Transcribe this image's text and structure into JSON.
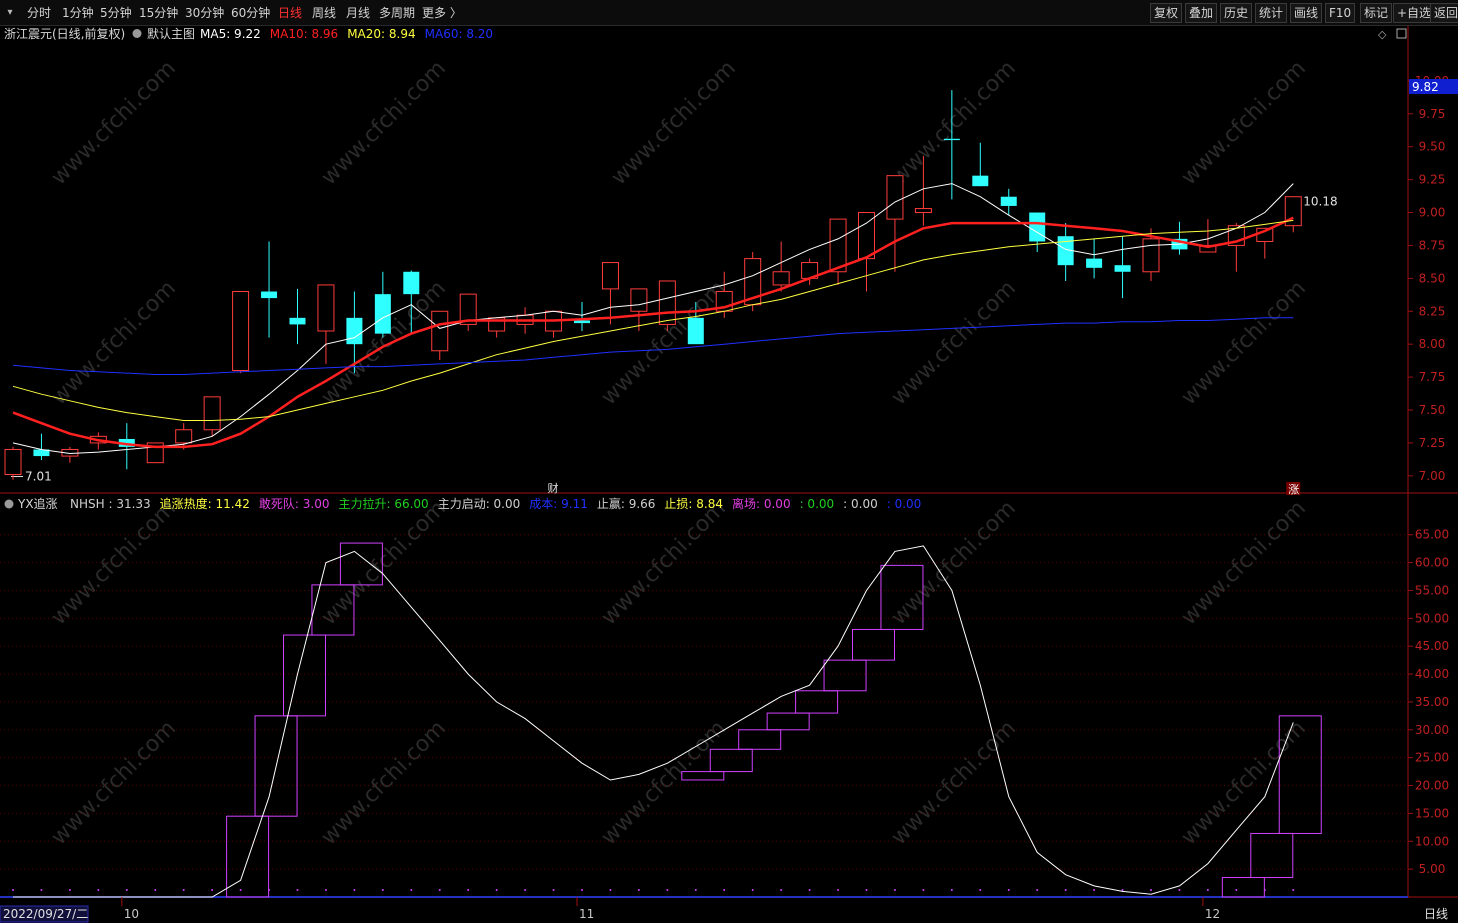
{
  "toolbar": {
    "periods": [
      "分时",
      "1分钟",
      "5分钟",
      "15分钟",
      "30分钟",
      "60分钟",
      "日线",
      "周线",
      "月线",
      "多周期",
      "更多 〉"
    ],
    "active_period": "日线",
    "right": [
      "复权",
      "叠加",
      "历史",
      "统计",
      "画线",
      "F10",
      "标记",
      "+自选",
      "返回"
    ]
  },
  "main_legend": {
    "stock": "浙江震元(日线,前复权)",
    "template": "默认主图",
    "items": [
      {
        "label": "MA5: 9.22",
        "color": "#ffffff"
      },
      {
        "label": "MA10: 8.96",
        "color": "#ff2020"
      },
      {
        "label": "MA20: 8.94",
        "color": "#ffff40"
      },
      {
        "label": "MA60: 8.20",
        "color": "#2030ff"
      }
    ]
  },
  "sub_legend": {
    "name": "YX追涨",
    "items": [
      {
        "label": "NHSH : 31.33",
        "color": "#d0d0d0"
      },
      {
        "label": "追涨热度: 11.42",
        "color": "#ffff40"
      },
      {
        "label": "敢死队: 3.00",
        "color": "#e040e0"
      },
      {
        "label": "主力拉升: 66.00",
        "color": "#20d020"
      },
      {
        "label": "主力启动: 0.00",
        "color": "#d0d0d0"
      },
      {
        "label": "成本: 9.11",
        "color": "#2030ff"
      },
      {
        "label": "止赢: 9.66",
        "color": "#d0d0d0"
      },
      {
        "label": "止损: 8.84",
        "color": "#ffff40"
      },
      {
        "label": "离场: 0.00",
        "color": "#e040e0"
      },
      {
        "label": ": 0.00",
        "color": "#20d020"
      },
      {
        "label": ": 0.00",
        "color": "#d0d0d0"
      },
      {
        "label": ": 0.00",
        "color": "#2030ff"
      }
    ]
  },
  "price_badge": "9.82",
  "max_label": "10.18",
  "min_label": "7.01",
  "markers": {
    "cai": "财",
    "zhang": "涨"
  },
  "date_label": "2022/09/27/二",
  "period_label": "日线",
  "watermark": "www.cfchi.com",
  "colors": {
    "up": "#ff3c3c",
    "down": "#30ffff",
    "ma5": "#ffffff",
    "ma10": "#ff2020",
    "ma20": "#ffff40",
    "ma60": "#2030ff",
    "sub_line": "#ffffff",
    "sub_box": "#d040ff",
    "grid": "#5a0000",
    "axis": "#a01010"
  },
  "chart_data": [
    {
      "type": "candlestick",
      "x": [
        "09-27",
        "09-28",
        "09-29",
        "09-30",
        "10-10",
        "10-11",
        "10-12",
        "10-13",
        "10-14",
        "10-17",
        "10-18",
        "10-19",
        "10-20",
        "10-21",
        "10-24",
        "10-25",
        "10-26",
        "10-27",
        "10-28",
        "10-31",
        "11-01",
        "11-02",
        "11-03",
        "11-04",
        "11-07",
        "11-08",
        "11-09",
        "11-10",
        "11-11",
        "11-14",
        "11-15",
        "11-16",
        "11-17",
        "11-18",
        "11-21",
        "11-22",
        "11-23",
        "11-24",
        "11-25",
        "11-28",
        "11-29",
        "11-30",
        "12-01",
        "12-02",
        "12-05",
        "12-06"
      ],
      "open": [
        7.01,
        7.2,
        7.15,
        7.25,
        7.28,
        7.1,
        7.25,
        7.35,
        7.8,
        8.4,
        8.2,
        8.1,
        8.2,
        8.38,
        8.55,
        7.95,
        8.15,
        8.1,
        8.15,
        8.1,
        8.18,
        8.42,
        8.25,
        8.15,
        8.2,
        8.25,
        8.3,
        8.45,
        8.5,
        8.55,
        8.65,
        8.95,
        9.0,
        9.56,
        9.28,
        9.12,
        9.0,
        8.82,
        8.65,
        8.6,
        8.55,
        8.8,
        8.7,
        8.75,
        8.78,
        8.9
      ],
      "high": [
        7.22,
        7.32,
        7.22,
        7.33,
        7.4,
        7.25,
        7.4,
        7.6,
        8.4,
        8.78,
        8.42,
        8.28,
        8.4,
        8.55,
        8.56,
        8.1,
        8.3,
        8.2,
        8.28,
        8.25,
        8.32,
        8.52,
        8.35,
        8.3,
        8.32,
        8.55,
        8.7,
        8.78,
        8.65,
        8.62,
        9.0,
        9.28,
        9.43,
        9.93,
        9.53,
        9.18,
        9.0,
        8.92,
        8.8,
        8.82,
        8.88,
        8.93,
        8.95,
        8.92,
        8.8,
        9.1
      ],
      "low": [
        6.97,
        7.12,
        7.1,
        7.2,
        7.05,
        7.1,
        7.2,
        7.3,
        7.78,
        8.05,
        8.0,
        7.85,
        7.78,
        8.05,
        8.08,
        7.88,
        8.1,
        8.05,
        8.08,
        8.05,
        8.1,
        8.15,
        8.1,
        8.1,
        8.08,
        8.2,
        8.25,
        8.4,
        8.45,
        8.45,
        8.4,
        8.55,
        8.9,
        9.1,
        9.2,
        8.98,
        8.7,
        8.48,
        8.5,
        8.35,
        8.48,
        8.68,
        8.7,
        8.55,
        8.65,
        8.85
      ],
      "close": [
        7.2,
        7.15,
        7.2,
        7.3,
        7.22,
        7.25,
        7.35,
        7.6,
        8.4,
        8.35,
        8.15,
        8.45,
        8.0,
        8.08,
        8.38,
        8.25,
        8.38,
        8.2,
        8.22,
        8.25,
        8.16,
        8.62,
        8.42,
        8.48,
        8.0,
        8.4,
        8.65,
        8.55,
        8.62,
        8.95,
        9.0,
        9.28,
        9.03,
        9.55,
        9.2,
        9.05,
        8.78,
        8.6,
        8.58,
        8.55,
        8.8,
        8.72,
        8.75,
        8.9,
        8.88,
        9.12
      ]
    },
    {
      "type": "line",
      "x_ref": "candlestick.x",
      "series": [
        {
          "name": "MA5",
          "values": [
            7.25,
            7.2,
            7.17,
            7.18,
            7.2,
            7.22,
            7.24,
            7.3,
            7.45,
            7.62,
            7.8,
            8.0,
            8.05,
            8.2,
            8.3,
            8.12,
            8.18,
            8.2,
            8.22,
            8.25,
            8.22,
            8.28,
            8.3,
            8.35,
            8.4,
            8.45,
            8.52,
            8.62,
            8.72,
            8.8,
            8.92,
            9.08,
            9.18,
            9.22,
            9.12,
            8.98,
            8.85,
            8.72,
            8.68,
            8.72,
            8.75,
            8.76,
            8.8,
            8.88,
            9.0,
            9.22
          ]
        },
        {
          "name": "MA10",
          "values": [
            7.48,
            7.4,
            7.32,
            7.27,
            7.24,
            7.22,
            7.22,
            7.24,
            7.32,
            7.45,
            7.6,
            7.72,
            7.85,
            7.98,
            8.08,
            8.15,
            8.18,
            8.18,
            8.18,
            8.18,
            8.19,
            8.2,
            8.22,
            8.24,
            8.25,
            8.28,
            8.35,
            8.42,
            8.5,
            8.58,
            8.66,
            8.78,
            8.88,
            8.92,
            8.92,
            8.92,
            8.92,
            8.9,
            8.88,
            8.86,
            8.82,
            8.78,
            8.74,
            8.78,
            8.86,
            8.96
          ]
        },
        {
          "name": "MA20",
          "values": [
            7.68,
            7.62,
            7.57,
            7.52,
            7.48,
            7.45,
            7.42,
            7.42,
            7.43,
            7.45,
            7.5,
            7.55,
            7.6,
            7.65,
            7.72,
            7.78,
            7.85,
            7.92,
            7.97,
            8.02,
            8.06,
            8.1,
            8.14,
            8.18,
            8.21,
            8.25,
            8.3,
            8.34,
            8.4,
            8.46,
            8.52,
            8.58,
            8.64,
            8.68,
            8.71,
            8.74,
            8.76,
            8.78,
            8.8,
            8.82,
            8.84,
            8.85,
            8.86,
            8.88,
            8.91,
            8.94
          ]
        },
        {
          "name": "MA60",
          "values": [
            7.84,
            7.82,
            7.8,
            7.79,
            7.78,
            7.77,
            7.77,
            7.78,
            7.79,
            7.8,
            7.81,
            7.82,
            7.83,
            7.83,
            7.84,
            7.85,
            7.86,
            7.87,
            7.88,
            7.9,
            7.92,
            7.94,
            7.95,
            7.96,
            7.98,
            8.0,
            8.02,
            8.04,
            8.06,
            8.08,
            8.09,
            8.1,
            8.11,
            8.12,
            8.13,
            8.14,
            8.15,
            8.16,
            8.16,
            8.17,
            8.17,
            8.18,
            8.18,
            8.19,
            8.2,
            8.2
          ]
        }
      ],
      "ylim": [
        6.9,
        10.28
      ],
      "y_ticks": [
        7.0,
        7.25,
        7.5,
        7.75,
        8.0,
        8.25,
        8.5,
        8.75,
        9.0,
        9.25,
        9.5,
        9.75,
        10.0
      ],
      "grid": false
    },
    {
      "type": "line",
      "name": "YX追涨",
      "x_ref": "candlestick.x",
      "series": [
        {
          "name": "NHSH",
          "values": [
            0,
            0,
            0,
            0,
            0,
            0,
            0,
            0,
            3,
            18,
            40,
            60,
            62,
            58,
            52,
            46,
            40,
            35,
            32,
            28,
            24,
            21,
            22,
            24,
            27,
            30,
            33,
            36,
            38,
            45,
            55,
            62,
            63,
            55,
            38,
            18,
            8,
            4,
            2,
            1,
            0.5,
            2,
            6,
            12,
            18,
            31.33
          ]
        }
      ],
      "boxes": [
        [
          8,
          0,
          14.5
        ],
        [
          9,
          14.5,
          32.5
        ],
        [
          10,
          32.5,
          47
        ],
        [
          11,
          47,
          56
        ],
        [
          12,
          56,
          63.5
        ],
        [
          24,
          21,
          22.5
        ],
        [
          25,
          22.5,
          26.5
        ],
        [
          26,
          26.5,
          30
        ],
        [
          27,
          30,
          33
        ],
        [
          28,
          33,
          37
        ],
        [
          29,
          37,
          42.5
        ],
        [
          30,
          42.5,
          48
        ],
        [
          31,
          48,
          59.5
        ],
        [
          43,
          0,
          3.5
        ],
        [
          44,
          3.5,
          11.4
        ],
        [
          45,
          11.4,
          32.5
        ]
      ],
      "ylim": [
        0,
        68
      ],
      "y_ticks": [
        5,
        10,
        15,
        20,
        25,
        30,
        35,
        40,
        45,
        50,
        55,
        60,
        65
      ],
      "grid": true
    }
  ],
  "x_axis_labels": [
    {
      "label": "10",
      "index": 4
    },
    {
      "label": "11",
      "index": 20
    },
    {
      "label": "12",
      "index": 42
    }
  ]
}
